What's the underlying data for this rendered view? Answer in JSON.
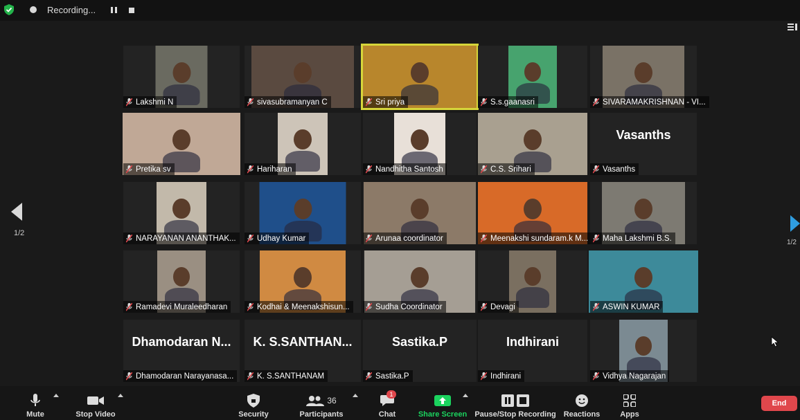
{
  "topbar": {
    "recording_label": "Recording..."
  },
  "pagination": {
    "left": "1/2",
    "right": "1/2"
  },
  "colors": {
    "active_border": "#d6d63a",
    "share_green": "#1bd35e",
    "end_red": "#e0474c",
    "next_blue": "#2f9de0"
  },
  "participants": [
    {
      "name": "Lakshmi N",
      "bg": "#6a6a60"
    },
    {
      "name": "sivasubramanyan C",
      "bg": "#5a4a40"
    },
    {
      "name": "Sri priya",
      "bg": "#b8862c",
      "active": true
    },
    {
      "name": "S.s.gaanasri",
      "bg": "#47a36e"
    },
    {
      "name": "SIVARAMAKRISHNAN - VI...",
      "bg": "#7a7266"
    },
    {
      "name": "Pretika sv",
      "bg": "#c0a896"
    },
    {
      "name": "Hariharan",
      "bg": "#cdc4b8"
    },
    {
      "name": "Nandhitha Santosh",
      "bg": "#e8e0d8"
    },
    {
      "name": "C.S. Srihari",
      "bg": "#a9a090"
    },
    {
      "name": "Vasanths",
      "big": "Vasanths"
    },
    {
      "name": "NARAYANAN ANANTHAK...",
      "bg": "#c2b9aa"
    },
    {
      "name": "Udhay Kumar",
      "bg": "#1f4f8a"
    },
    {
      "name": "Arunaa coordinator",
      "bg": "#8c7a68"
    },
    {
      "name": "Meenakshi sundaram.k M...",
      "bg": "#d86a28"
    },
    {
      "name": "Maha Lakshmi B.S.",
      "bg": "#7d7a72"
    },
    {
      "name": "Ramadevi Muraleedharan",
      "bg": "#9a8f82"
    },
    {
      "name": "Kodhai & Meenakshisun...",
      "bg": "#d08a42"
    },
    {
      "name": "Sudha Coordinator",
      "bg": "#a59e94"
    },
    {
      "name": "Devagi",
      "bg": "#7a6f60"
    },
    {
      "name": "ASWIN KUMAR",
      "bg": "#3d8a9a"
    },
    {
      "name": "Dhamodaran Narayanasa...",
      "big": "Dhamodaran  N..."
    },
    {
      "name": "K. S.SANTHANAM",
      "big": "K.  S.SANTHAN..."
    },
    {
      "name": "Sastika.P",
      "big": "Sastika.P"
    },
    {
      "name": "Indhirani",
      "big": "Indhirani"
    },
    {
      "name": "Vidhya Nagarajan",
      "bg": "#7b8a92"
    }
  ],
  "toolbar": {
    "mute": "Mute",
    "stop_video": "Stop Video",
    "security": "Security",
    "participants": "Participants",
    "participants_count": "36",
    "chat": "Chat",
    "chat_badge": "1",
    "share_screen": "Share Screen",
    "pause_stop_recording": "Pause/Stop Recording",
    "reactions": "Reactions",
    "apps": "Apps",
    "end": "End"
  }
}
